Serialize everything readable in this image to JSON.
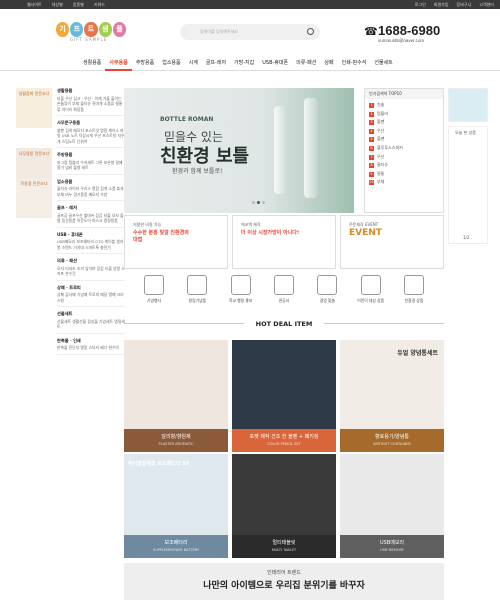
{
  "topbar": {
    "left": [
      "웹사이트",
      "대상별",
      "업종별",
      "키워드"
    ],
    "right": [
      "로그인",
      "회원가입",
      "장바구니",
      "고객센터"
    ]
  },
  "logo": {
    "letters": [
      "기",
      "프",
      "트",
      "샘",
      "플"
    ],
    "sub": "GIFT SAMPLE",
    "colors": [
      "#f2a93b",
      "#66bbd8",
      "#e8734d",
      "#a3cd4e",
      "#e07aa6"
    ]
  },
  "search": {
    "placeholder": "검색어를 입력해주세요"
  },
  "contact": {
    "phone": "1688-6980",
    "email": "summul45@naver.com"
  },
  "nav": [
    "생활용품",
    "사무용품",
    "주방용품",
    "업소용품",
    "시계",
    "골프-레저",
    "가방-지갑",
    "USB-휴대폰",
    "의류-패션",
    "상패",
    "인쇄-판수석",
    "선물세트"
  ],
  "nav_active": 1,
  "left_banners": [
    {
      "title": "생활잡화 전문코너"
    },
    {
      "title": "사무용품 전문코너"
    },
    {
      "title": "학용품 전문코너"
    }
  ],
  "sidebar": [
    {
      "title": "생활용품",
      "desc": "타올 우산 심크 · 우산 · 이케 거울 둘이는 손톱깎이 부채 물티슈 귀마개 소품류 필통류 아이리 화장품"
    },
    {
      "title": "사무문구용품",
      "desc": "볼펜 검색 메모지 포스트잇 명함 케이스 파일 USB 노트 탁상시계 우산 포스트잇 지우개 스팀노트 단위여"
    },
    {
      "title": "주방용품",
      "desc": "머그컵 텀블러 수저세트 그릇 보온병 밀폐용기 냄비 물병 세트"
    },
    {
      "title": "업소용품",
      "desc": "물티슈 라이터 우리스 명함 집게 소품 효과 부채 비누 경기용품 메모지 가방"
    },
    {
      "title": "골프 · 레저",
      "desc": "골프공 골프우산 볼마커 장갑 타올 모자 물병 등산용품 아웃도어 마스크 캠핑용품"
    },
    {
      "title": "USB · 휴대폰",
      "desc": "USB메모리 보조배터리 OTG 케이블 셀카봉 스탠드 거치대 스마트톡 충전기"
    },
    {
      "title": "의류 · 패션",
      "desc": "모자 티셔츠 조끼 앞치마 장갑 타올 양말 스카프 손수건"
    },
    {
      "title": "상패 · 트로피",
      "desc": "상패 감사패 기념패 트로피 메달 명패 크리스탈"
    },
    {
      "title": "선물세트",
      "desc": "선물세트 생활선물 정성물 기념세트 명절세트"
    },
    {
      "title": "판촉물 · 인쇄",
      "desc": "판촉물 전단지 명함 스티커 배너 현수막"
    }
  ],
  "hero": {
    "brand": "BOTTLE ROMAN",
    "line1": "믿을수 있는",
    "line2": "친환경 보틀",
    "line3": "환경과 함께 보틀로!"
  },
  "rank": {
    "title": "인기검색어 TOP10",
    "items": [
      "칫솔",
      "텀블러",
      "볼펜",
      "우산",
      "볼펜",
      "블루투스스피커",
      "우산",
      "물티슈",
      "필통",
      "부채"
    ]
  },
  "right": {
    "box1": "오늘 본 상품",
    "box1_count": "1/2"
  },
  "promos": [
    {
      "top": "저렴한 비용 가능",
      "bold": "수수한 분홍 빛깔 친환경의 대접"
    },
    {
      "top": "에코백 제작",
      "bold": "더 이상 시장가방이 아니다!"
    },
    {
      "top": "주문제작 EVENT",
      "bold": "EVENT"
    }
  ],
  "icons": [
    "기념행사",
    "창립기념품",
    "학교 행정 홍보",
    "관공서",
    "경영 맞춤",
    "어린이 대상 상품",
    "친환경 상품"
  ],
  "deal_title": "HOT DEAL ITEM",
  "cards": [
    {
      "name": "달리향/향원제",
      "en": "PLASTER AROMATIC",
      "color": "#8b5a3a"
    },
    {
      "name": "포켓 제작 건조 한 볼펜 + 패키징",
      "en": "COLOR PENCIL SET",
      "color": "#d9663b"
    },
    {
      "name": "향료용기/양념통",
      "en": "AIRTIGHT CONTAINER",
      "color": "#a66b2c"
    },
    {
      "name": "보조배터리",
      "en": "SUPPLEMENTARY BATTERY",
      "color": "#6f8aa0"
    },
    {
      "name": "멀티태블릿",
      "en": "MULTI TABLET",
      "color": "#2b2b2b"
    },
    {
      "name": "USB메모리",
      "en": "USB MEMORY",
      "color": "#5f5f5f"
    }
  ],
  "card_tags": [
    "케이블일체형 보조배터리 S9",
    "듀얼 양념통세트"
  ],
  "banner2": {
    "sub": "인테리어 트렌드",
    "title": "나만의 아이템으로 우리집 분위기를 바꾸자"
  }
}
